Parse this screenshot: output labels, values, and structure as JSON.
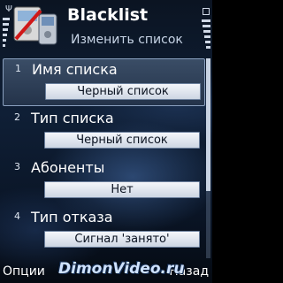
{
  "header": {
    "app_title": "Blacklist",
    "subtitle": "Изменить список",
    "icons": [
      "antenna-icon",
      "app-phone-icon",
      "battery-icon"
    ]
  },
  "list": {
    "items": [
      {
        "number": "1",
        "label": "Имя списка",
        "value": "Черный список",
        "focused": true
      },
      {
        "number": "2",
        "label": "Тип списка",
        "value": "Черный список",
        "focused": false
      },
      {
        "number": "3",
        "label": "Абоненты",
        "value": "Нет",
        "focused": false
      },
      {
        "number": "4",
        "label": "Тип отказа",
        "value": "Сигнал 'занято'",
        "focused": false
      }
    ]
  },
  "softkeys": {
    "left": "Опции",
    "right": "Назад"
  },
  "watermark": "DimonVideo.ru",
  "colors": {
    "background": "#0f1f36",
    "focus": "#3a4d66",
    "value_field": "#e6ebf2"
  }
}
